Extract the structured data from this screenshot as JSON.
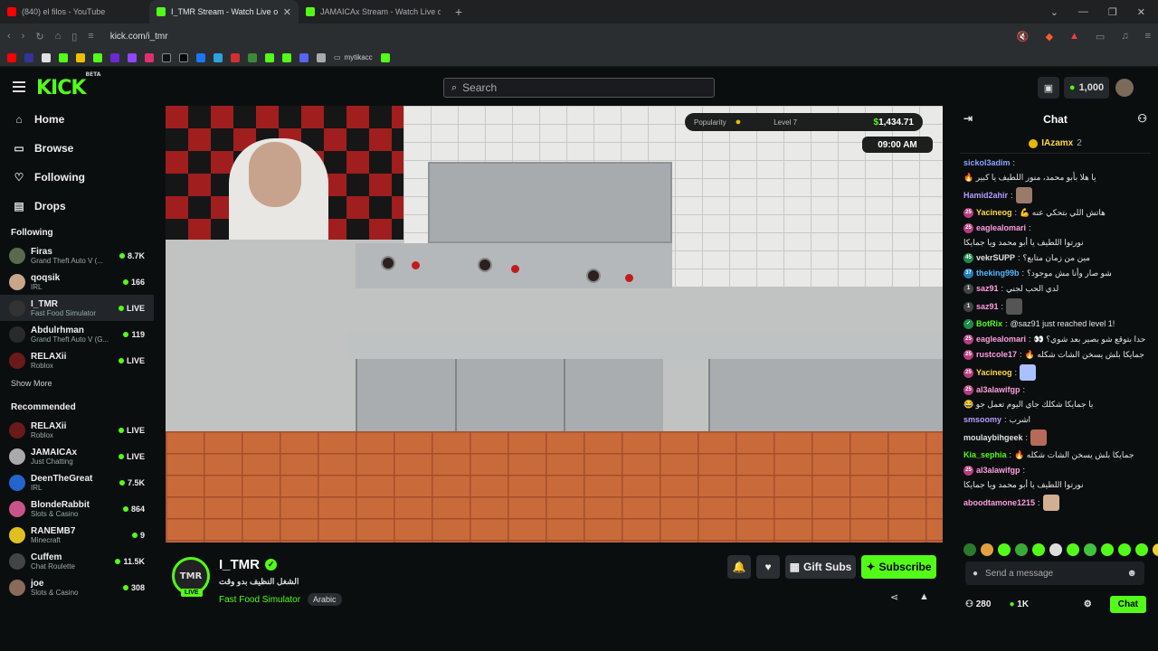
{
  "browser": {
    "tabs": [
      {
        "title": "(840) el filos - YouTube",
        "color": "#ff0000",
        "active": false
      },
      {
        "title": "I_TMR Stream - Watch Live o",
        "color": "#53fc18",
        "active": true
      },
      {
        "title": "JAMAICAx Stream - Watch Live o",
        "color": "#53fc18",
        "active": false
      }
    ],
    "new_tab": "+",
    "url": "kick.com/i_tmr",
    "bookmark_folder": "mytikacc"
  },
  "header": {
    "logo": "KICK",
    "logo_sup": "BETA",
    "search_placeholder": "Search",
    "points": "1,000"
  },
  "sidebar": {
    "nav": [
      {
        "label": "Home",
        "icon": "home-icon",
        "glyph": "⌂"
      },
      {
        "label": "Browse",
        "icon": "browse-icon",
        "glyph": "▭"
      },
      {
        "label": "Following",
        "icon": "heart-icon",
        "glyph": "♡"
      },
      {
        "label": "Drops",
        "icon": "drops-icon",
        "glyph": "▤"
      }
    ],
    "following_title": "Following",
    "following": [
      {
        "name": "Firas",
        "category": "Grand Theft Auto V (...",
        "viewers": "8.7K",
        "color": "#5a6a4a"
      },
      {
        "name": "qoqsik",
        "category": "IRL",
        "viewers": "166",
        "color": "#c9a58a"
      },
      {
        "name": "I_TMR",
        "category": "Fast Food Simulator",
        "viewers": "LIVE",
        "color": "#333"
      },
      {
        "name": "Abdulrhman",
        "category": "Grand Theft Auto V (G...",
        "viewers": "119",
        "color": "#2a2a2a"
      },
      {
        "name": "RELAXii",
        "category": "Roblox",
        "viewers": "LIVE",
        "color": "#6a1a1a"
      }
    ],
    "show_more": "Show More",
    "recommended_title": "Recommended",
    "recommended": [
      {
        "name": "RELAXii",
        "category": "Roblox",
        "viewers": "LIVE",
        "color": "#6a1a1a"
      },
      {
        "name": "JAMAICAx",
        "category": "Just Chatting",
        "viewers": "LIVE",
        "color": "#aaa"
      },
      {
        "name": "DeenTheGreat",
        "category": "IRL",
        "viewers": "7.5K",
        "color": "#2266cc"
      },
      {
        "name": "BlondeRabbit",
        "category": "Slots & Casino",
        "viewers": "864",
        "color": "#c9548a"
      },
      {
        "name": "RANEMB7",
        "category": "Minecraft",
        "viewers": "9",
        "color": "#e0c020"
      },
      {
        "name": "Cuffem",
        "category": "Chat Roulette",
        "viewers": "11.5K",
        "color": "#444"
      },
      {
        "name": "joe",
        "category": "Slots & Casino",
        "viewers": "308",
        "color": "#8a6a5a"
      }
    ]
  },
  "video": {
    "popularity_label": "Popularity",
    "level_label": "Level 7",
    "money_symbol": "$",
    "money_value": "1,434.71",
    "time": "09:00 AM"
  },
  "stream": {
    "name": "I_TMR",
    "avatar_text": "TMR",
    "live_badge": "LIVE",
    "title": "الشغل النظيف بدو وقت",
    "category": "Fast Food Simulator",
    "tag": "Arabic",
    "gift_label": "Gift Subs",
    "subscribe_label": "Subscribe"
  },
  "chat": {
    "title": "Chat",
    "pinned_user": "IAzamx",
    "pinned_count": "2",
    "messages": [
      {
        "user": "sickol3adim",
        "color": "#8aa3ff",
        "badge": "",
        "badge_color": "",
        "text": "يا هلا بأبو محمد، منور اللطيف يا كبير 🔥"
      },
      {
        "user": "Hamid2ahir",
        "color": "#b69cff",
        "badge": "",
        "badge_color": "",
        "text": "",
        "emote": "#9a7a6a"
      },
      {
        "user": "Yacineog",
        "color": "#ffd84a",
        "badge": "25",
        "badge_color": "#b83b7f",
        "text": "هاتش اللي بتحكي عنه 💪"
      },
      {
        "user": "eaglealomari",
        "color": "#ff9de0",
        "badge": "25",
        "badge_color": "#b83b7f",
        "text": "نورتوا اللطيف يا أبو محمد ويا جمايكا"
      },
      {
        "user": "vekrSUPP",
        "color": "#e0e0e0",
        "badge": "45",
        "badge_color": "#1f8a4c",
        "text": "مين من زمان متابع؟"
      },
      {
        "user": "theking99b",
        "color": "#53b7ff",
        "badge": "37",
        "badge_color": "#1f7ab8",
        "text": "شو صار وأنا مش موجود؟"
      },
      {
        "user": "saz91",
        "color": "#ff9de0",
        "badge": "1",
        "badge_color": "#444",
        "text": "لدي الحب لجني"
      },
      {
        "user": "saz91",
        "color": "#ff9de0",
        "badge": "1",
        "badge_color": "#444",
        "text": "",
        "emote": "#555"
      },
      {
        "user": "BotRix",
        "color": "#53fc18",
        "badge": "✓",
        "badge_color": "#1f8a4c",
        "text": "@saz91 just reached level 1!"
      },
      {
        "user": "eaglealomari",
        "color": "#ff9de0",
        "badge": "25",
        "badge_color": "#b83b7f",
        "text": "حدا بتوقع شو بصير بعد شوي؟ 👀"
      },
      {
        "user": "rustcole17",
        "color": "#ff9de0",
        "badge": "25",
        "badge_color": "#b83b7f",
        "text": "جمايكا بلش يسخن الشات شكله 🔥"
      },
      {
        "user": "Yacineog",
        "color": "#ffd84a",
        "badge": "25",
        "badge_color": "#b83b7f",
        "text": "",
        "emote": "#aac0ff"
      },
      {
        "user": "al3alawifgp",
        "color": "#ff9de0",
        "badge": "25",
        "badge_color": "#b83b7f",
        "text": "يا جمايكا شكلك جاي اليوم تعمل جو 😂"
      },
      {
        "user": "smsoomy",
        "color": "#b69cff",
        "badge": "",
        "badge_color": "",
        "text": "اشرب"
      },
      {
        "user": "moulaybihgeek",
        "color": "#e0e0e0",
        "badge": "",
        "badge_color": "",
        "text": "",
        "emote": "#b56a5a"
      },
      {
        "user": "Kia_sephia",
        "color": "#53fc18",
        "badge": "",
        "badge_color": "",
        "text": "جمايكا بلش يسخن الشات شكله 🔥"
      },
      {
        "user": "al3alawifgp",
        "color": "#ff9de0",
        "badge": "25",
        "badge_color": "#b83b7f",
        "text": "نورتوا اللطيف يا أبو محمد ويا جمايكا"
      },
      {
        "user": "aboodtamone1215",
        "color": "#ff9de0",
        "badge": "",
        "badge_color": "",
        "text": "",
        "emote": "#d0b090"
      }
    ],
    "input_placeholder": "Send a message",
    "viewers": "280",
    "points": "1K",
    "send_label": "Chat"
  }
}
